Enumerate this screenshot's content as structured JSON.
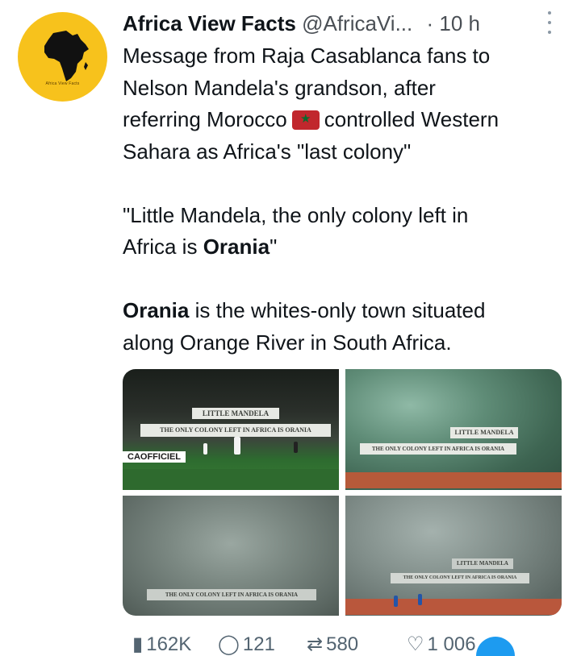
{
  "tweet": {
    "display_name": "Africa View Facts",
    "handle": "@AfricaVi...",
    "separator": "·",
    "time": "10 h",
    "avatar_caption": "Africa View Facts",
    "lines": {
      "l1": "Message from Raja Casablanca fans to",
      "l2": "Nelson Mandela's grandson, after",
      "l3a": "referring Morocco",
      "l3b": "controlled Western",
      "l4": "Sahara as Africa's \"last colony\"",
      "q1": "\"Little Mandela, the only colony left in",
      "q2a": "Africa is ",
      "q2b": "Orania",
      "q2c": "\"",
      "o1a": "Orania",
      "o1b": " is the whites-only town situated",
      "o2": "along Orange River in South Africa."
    }
  },
  "media": {
    "img1": {
      "banner_top": "LITTLE MANDELA",
      "banner_bottom": "THE ONLY COLONY LEFT IN AFRICA IS ORANIA",
      "watermark": "CAOFFICIEL"
    },
    "img2": {
      "banner_top": "LITTLE MANDELA",
      "banner_bottom": "THE ONLY COLONY LEFT IN AFRICA IS ORANIA"
    },
    "img3": {
      "banner_bottom": "THE ONLY COLONY LEFT IN AFRICA IS ORANIA"
    },
    "img4": {
      "banner_top": "LITTLE MANDELA",
      "banner_bottom": "THE ONLY COLONY LEFT IN AFRICA IS ORANIA"
    }
  },
  "actions": {
    "views": "162K",
    "replies": "121",
    "retweets": "580",
    "likes": "1 006"
  },
  "colors": {
    "avatar_bg": "#f7c21c",
    "flag_red": "#c1272d",
    "flag_star": "#0b6a2e",
    "accent_blue": "#1d9bf0"
  }
}
